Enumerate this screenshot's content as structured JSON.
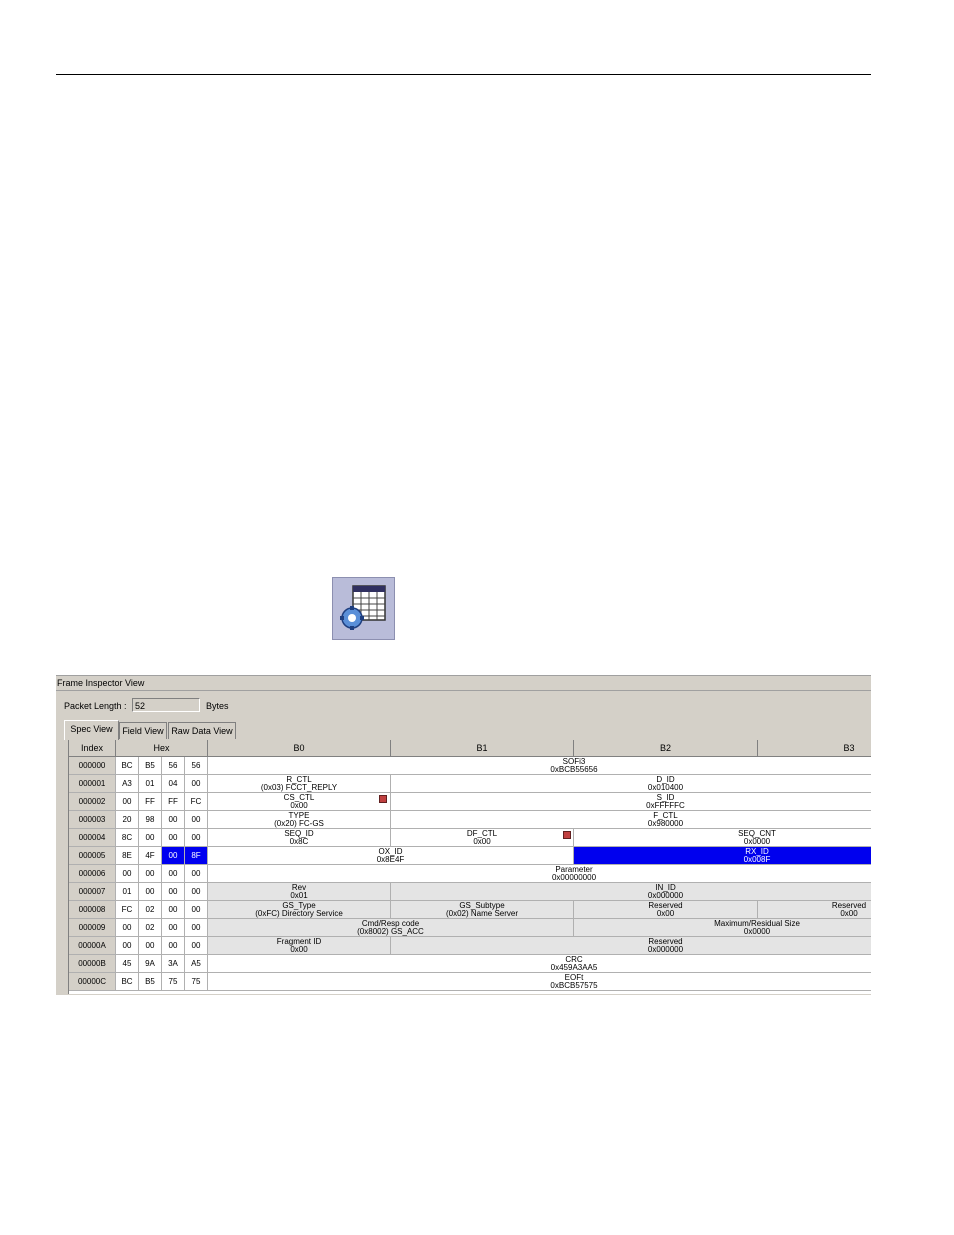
{
  "window": {
    "title": "Frame Inspector View"
  },
  "packet": {
    "label": "Packet Length :",
    "value": "52",
    "unit": "Bytes"
  },
  "tabs": [
    "Spec View",
    "Field View",
    "Raw Data View"
  ],
  "icon": {
    "name": "frame-inspector-icon"
  },
  "columns": {
    "index": "Index",
    "hex": "Hex",
    "bytes": [
      "B0",
      "B1",
      "B2",
      "B3"
    ]
  },
  "rows": [
    {
      "index": "000000",
      "hex": [
        "BC",
        "B5",
        "56",
        "56"
      ]
    },
    {
      "index": "000001",
      "hex": [
        "A3",
        "01",
        "04",
        "00"
      ]
    },
    {
      "index": "000002",
      "hex": [
        "00",
        "FF",
        "FF",
        "FC"
      ]
    },
    {
      "index": "000003",
      "hex": [
        "20",
        "98",
        "00",
        "00"
      ]
    },
    {
      "index": "000004",
      "hex": [
        "8C",
        "00",
        "00",
        "00"
      ]
    },
    {
      "index": "000005",
      "hex": [
        "8E",
        "4F",
        "00",
        "8F"
      ]
    },
    {
      "index": "000006",
      "hex": [
        "00",
        "00",
        "00",
        "00"
      ]
    },
    {
      "index": "000007",
      "hex": [
        "01",
        "00",
        "00",
        "00"
      ]
    },
    {
      "index": "000008",
      "hex": [
        "FC",
        "02",
        "00",
        "00"
      ]
    },
    {
      "index": "000009",
      "hex": [
        "00",
        "02",
        "00",
        "00"
      ]
    },
    {
      "index": "00000A",
      "hex": [
        "00",
        "00",
        "00",
        "00"
      ]
    },
    {
      "index": "00000B",
      "hex": [
        "45",
        "9A",
        "3A",
        "A5"
      ]
    },
    {
      "index": "00000C",
      "hex": [
        "BC",
        "B5",
        "75",
        "75"
      ]
    }
  ],
  "fields": [
    {
      "row": 0,
      "span": "0-3",
      "name": "SOFi3",
      "value": "0xBCB55656"
    },
    {
      "row": 1,
      "span": "0",
      "name": "R_CTL",
      "value": "(0x03) FCCT_REPLY"
    },
    {
      "row": 1,
      "span": "1-3",
      "name": "D_ID",
      "value": "0x010400"
    },
    {
      "row": 2,
      "span": "0",
      "name": "CS_CTL",
      "value": "0x00"
    },
    {
      "row": 2,
      "span": "1-3",
      "name": "S_ID",
      "value": "0xFFFFFC"
    },
    {
      "row": 3,
      "span": "0",
      "name": "TYPE",
      "value": "(0x20) FC-GS"
    },
    {
      "row": 3,
      "span": "1-3",
      "name": "F_CTL",
      "value": "0x980000"
    },
    {
      "row": 4,
      "span": "0",
      "name": "SEQ_ID",
      "value": "0x8C"
    },
    {
      "row": 4,
      "span": "1",
      "name": "DF_CTL",
      "value": "0x00"
    },
    {
      "row": 4,
      "span": "2-3",
      "name": "SEQ_CNT",
      "value": "0x0000"
    },
    {
      "row": 5,
      "span": "0-1",
      "name": "OX_ID",
      "value": "0x8E4F"
    },
    {
      "row": 5,
      "span": "2-3",
      "name": "RX_ID",
      "value": "0x008F"
    },
    {
      "row": 6,
      "span": "0-3",
      "name": "Parameter",
      "value": "0x00000000"
    },
    {
      "row": 7,
      "span": "0",
      "name": "Rev",
      "value": "0x01"
    },
    {
      "row": 7,
      "span": "1-3",
      "name": "IN_ID",
      "value": "0x000000"
    },
    {
      "row": 8,
      "span": "0",
      "name": "GS_Type",
      "value": "(0xFC) Directory Service"
    },
    {
      "row": 8,
      "span": "1",
      "name": "GS_Subtype",
      "value": "(0x02) Name Server"
    },
    {
      "row": 8,
      "span": "2",
      "name": "Reserved",
      "value": "0x00"
    },
    {
      "row": 8,
      "span": "3",
      "name": "Reserved",
      "value": "0x00"
    },
    {
      "row": 9,
      "span": "0-1",
      "name": "Cmd/Resp code",
      "value": "(0x8002) GS_ACC"
    },
    {
      "row": 9,
      "span": "2-3",
      "name": "Maximum/Residual Size",
      "value": "0x0000"
    },
    {
      "row": 10,
      "span": "0",
      "name": "Fragment ID",
      "value": "0x00"
    },
    {
      "row": 10,
      "span": "1-3",
      "name": "Reserved",
      "value": "0x000000"
    },
    {
      "row": 11,
      "span": "0-3",
      "name": "CRC",
      "value": "0x459A3AA5"
    },
    {
      "row": 12,
      "span": "0-3",
      "name": "EOFt",
      "value": "0xBCB57575"
    }
  ]
}
